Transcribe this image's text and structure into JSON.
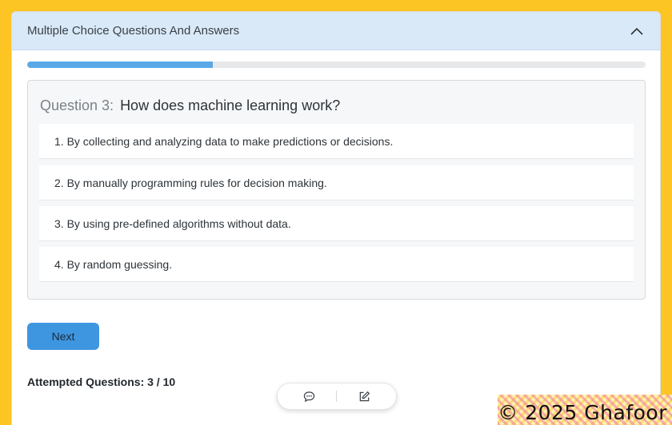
{
  "header": {
    "title": "Multiple Choice Questions And Answers",
    "toggle_icon": "chevron-up-icon"
  },
  "progress": {
    "fraction": 0.3
  },
  "question": {
    "number_label": "Question 3:",
    "text": "How does machine learning work?",
    "options": [
      "1. By collecting and analyzing data to make predictions or decisions.",
      "2. By manually programming rules for decision making.",
      "3. By using pre-defined algorithms without data.",
      "4. By random guessing."
    ]
  },
  "actions": {
    "next_label": "Next"
  },
  "status": {
    "attempted": "Attempted Questions: 3 / 10"
  },
  "floating_toolbar": {
    "icons": [
      "chat-icon",
      "edit-icon"
    ]
  },
  "watermark": {
    "text": "© 2025 Ghafoor"
  },
  "colors": {
    "accent": "#3f96e0",
    "progress": "#5aa9e6",
    "header_bg": "#d9e9f7",
    "frame": "#fdc524"
  }
}
